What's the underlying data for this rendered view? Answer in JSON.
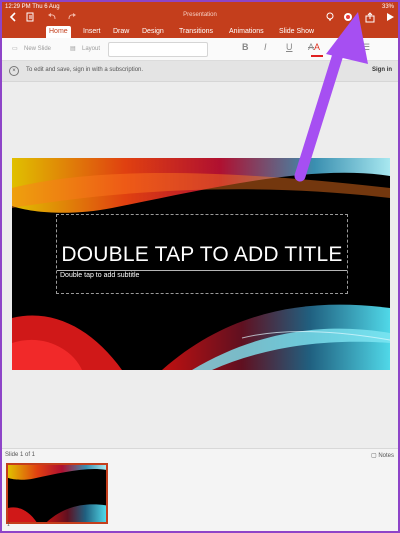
{
  "status": {
    "time_date": "12:29 PM  Thu 6 Aug",
    "battery": "33%"
  },
  "app": {
    "document_title": "Presentation"
  },
  "tabs": [
    "Home",
    "Insert",
    "Draw",
    "Design",
    "Transitions",
    "Animations",
    "Slide Show"
  ],
  "ribbon": {
    "new_slide": "New Slide",
    "layout": "Layout",
    "bold": "B",
    "italic": "I",
    "underline": "U",
    "strikethrough": "A",
    "font_color": "A",
    "font_color_value": "#e02020"
  },
  "signin_bar": {
    "message": "To edit and save, sign in with a subscription.",
    "action": "Sign in"
  },
  "slide": {
    "title_placeholder": "DOUBLE TAP TO ADD TITLE",
    "subtitle_placeholder": "Double tap to add subtitle"
  },
  "footer": {
    "slide_count": "Slide 1 of 1",
    "notes": "Notes",
    "thumb_number": "1"
  },
  "colors": {
    "accent": "#c43e1c",
    "annotation_arrow": "#a64ff2"
  }
}
